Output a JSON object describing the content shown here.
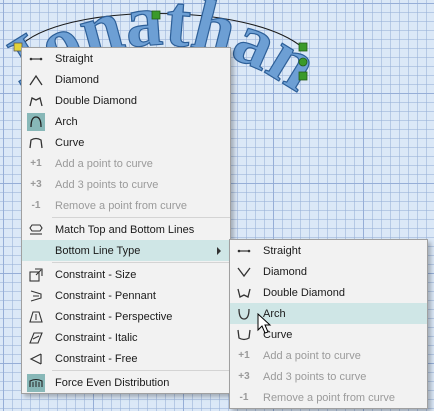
{
  "canvas": {
    "text": "Jonathan"
  },
  "menu": {
    "items": [
      {
        "label": "Straight",
        "icon": "straight-icon",
        "disabled": false
      },
      {
        "label": "Diamond",
        "icon": "diamond-icon",
        "disabled": false
      },
      {
        "label": "Double Diamond",
        "icon": "double-diamond-icon",
        "disabled": false
      },
      {
        "label": "Arch",
        "icon": "arch-icon",
        "disabled": false,
        "selected": true
      },
      {
        "label": "Curve",
        "icon": "curve-icon",
        "disabled": false
      },
      {
        "label": "Add a point to curve",
        "icon_text": "+1",
        "disabled": true
      },
      {
        "label": "Add 3 points to curve",
        "icon_text": "+3",
        "disabled": true
      },
      {
        "label": "Remove a point from curve",
        "icon_text": "-1",
        "disabled": true
      },
      {
        "label": "Match Top and Bottom Lines",
        "icon": "match-lines-icon",
        "disabled": false
      },
      {
        "label": "Bottom Line Type",
        "disabled": false,
        "highlighted": true,
        "submenu": true
      },
      {
        "label": "Constraint - Size",
        "icon": "constraint-size-icon",
        "disabled": false
      },
      {
        "label": "Constraint - Pennant",
        "icon": "constraint-pennant-icon",
        "disabled": false
      },
      {
        "label": "Constraint - Perspective",
        "icon": "constraint-perspective-icon",
        "disabled": false
      },
      {
        "label": "Constraint - Italic",
        "icon": "constraint-italic-icon",
        "disabled": false
      },
      {
        "label": "Constraint - Free",
        "icon": "constraint-free-icon",
        "disabled": false
      },
      {
        "label": "Force Even Distribution",
        "icon": "force-even-distribution-icon",
        "disabled": false
      }
    ]
  },
  "submenu": {
    "items": [
      {
        "label": "Straight",
        "icon": "straight-icon",
        "disabled": false
      },
      {
        "label": "Diamond",
        "icon": "diamond-down-icon",
        "disabled": false
      },
      {
        "label": "Double Diamond",
        "icon": "double-diamond-down-icon",
        "disabled": false
      },
      {
        "label": "Arch",
        "icon": "arch-down-icon",
        "disabled": false,
        "highlighted": true
      },
      {
        "label": "Curve",
        "icon": "curve-down-icon",
        "disabled": false
      },
      {
        "label": "Add a point to curve",
        "icon_text": "+1",
        "disabled": true
      },
      {
        "label": "Add 3 points to curve",
        "icon_text": "+3",
        "disabled": true
      },
      {
        "label": "Remove a point from curve",
        "icon_text": "-1",
        "disabled": true
      }
    ]
  },
  "colors": {
    "handle": "#3a9a2a",
    "highlight": "#cfe6e6",
    "selected_icon": "#88b8b8"
  }
}
